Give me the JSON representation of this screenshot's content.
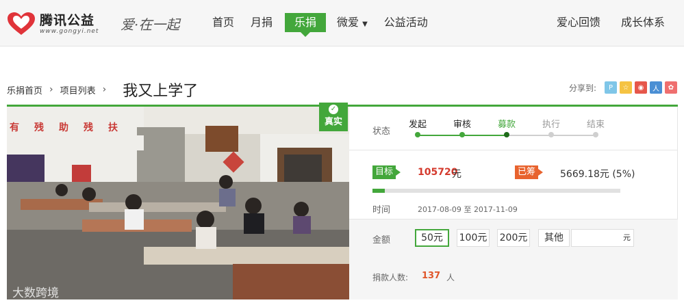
{
  "brand": {
    "name_cn": "腾讯公益",
    "url": "www.gongyi.net",
    "slogan": "爱·在一起",
    "accent": "#43a73b",
    "logo_red": "#e0343a"
  },
  "nav": {
    "items": [
      {
        "label": "首页"
      },
      {
        "label": "月捐"
      },
      {
        "label": "乐捐",
        "active": true
      },
      {
        "label": "微爱",
        "has_dropdown": true
      },
      {
        "label": "公益活动"
      }
    ],
    "right_items": [
      {
        "label": "爱心回馈"
      },
      {
        "label": "成长体系"
      }
    ]
  },
  "breadcrumb": {
    "items": [
      "乐捐首页",
      "项目列表"
    ],
    "separator_icon": "chevron-right"
  },
  "page_title": "我又上学了",
  "share": {
    "label": "分享到:",
    "icons": [
      {
        "name": "qzone",
        "color": "#7fc6e8",
        "glyph": "P"
      },
      {
        "name": "weibo-star",
        "color": "#f5c343",
        "glyph": "☆"
      },
      {
        "name": "sina-weibo",
        "color": "#e6574b",
        "glyph": "◉"
      },
      {
        "name": "renren",
        "color": "#4a8fd4",
        "glyph": "人"
      },
      {
        "name": "kaixin",
        "color": "#ef6f6f",
        "glyph": "✿"
      }
    ]
  },
  "photo": {
    "badge_text": "真实",
    "watermark": "大数跨境",
    "banner_text": "有残助残扶"
  },
  "status": {
    "label": "状态",
    "steps": [
      {
        "name": "发起",
        "done": true
      },
      {
        "name": "审核",
        "done": true
      },
      {
        "name": "募款",
        "current": true
      },
      {
        "name": "执行",
        "done": false
      },
      {
        "name": "结束",
        "done": false
      }
    ]
  },
  "funding": {
    "target_label": "目标",
    "target_value": "105720",
    "target_unit": "元",
    "raised_label": "已筹",
    "raised_value": "5669.18元 (5%)",
    "progress_fraction": 0.05,
    "time_label": "时间",
    "start_date": "2017-08-09",
    "date_sep": "至",
    "end_date": "2017-11-09"
  },
  "donate": {
    "amount_label": "金额",
    "options": [
      {
        "label": "50元",
        "selected": true
      },
      {
        "label": "100元"
      },
      {
        "label": "200元"
      },
      {
        "label": "其他"
      }
    ],
    "other_unit": "元",
    "donors_label": "捐款人数:",
    "donors_count": "137",
    "donors_unit": "人"
  }
}
